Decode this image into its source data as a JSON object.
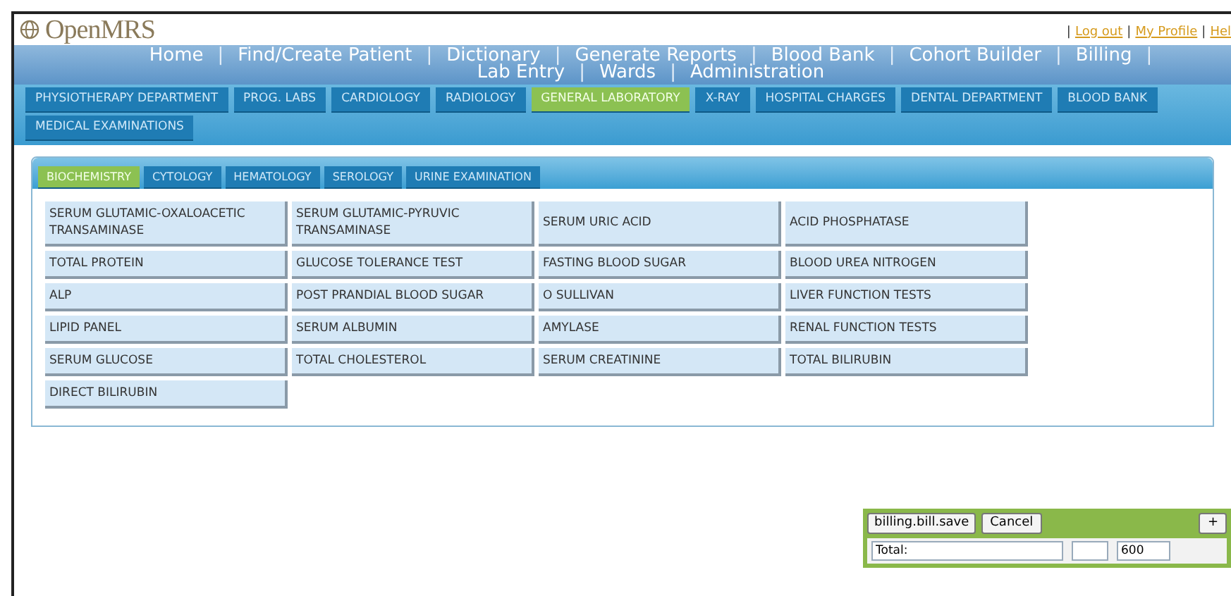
{
  "logo": {
    "text": "OpenMRS"
  },
  "top_links": [
    {
      "kind": "separator",
      "label": "|"
    },
    {
      "kind": "link",
      "label": "Log out"
    },
    {
      "kind": "separator",
      "label": "|"
    },
    {
      "kind": "link",
      "label": "My Profile"
    },
    {
      "kind": "separator",
      "label": "|"
    },
    {
      "kind": "link",
      "label": "Hel"
    }
  ],
  "nav": {
    "items": [
      {
        "kind": "link",
        "label": "Home"
      },
      {
        "kind": "separator",
        "label": "|"
      },
      {
        "kind": "link",
        "label": "Find/Create Patient"
      },
      {
        "kind": "separator",
        "label": "|"
      },
      {
        "kind": "link",
        "label": "Dictionary"
      },
      {
        "kind": "separator",
        "label": "|"
      },
      {
        "kind": "link",
        "label": "Generate Reports"
      },
      {
        "kind": "separator",
        "label": "|"
      },
      {
        "kind": "link",
        "label": "Blood Bank"
      },
      {
        "kind": "separator",
        "label": "|"
      },
      {
        "kind": "link",
        "label": "Cohort Builder"
      },
      {
        "kind": "separator",
        "label": "|"
      },
      {
        "kind": "link",
        "label": "Billing"
      },
      {
        "kind": "separator",
        "label": "|"
      },
      {
        "kind": "link",
        "label": "Lab Entry"
      },
      {
        "kind": "separator",
        "label": "|"
      },
      {
        "kind": "link",
        "label": "Wards"
      },
      {
        "kind": "separator",
        "label": "|"
      },
      {
        "kind": "link",
        "label": "Administration"
      }
    ]
  },
  "department_tabs": [
    {
      "label": "PHYSIOTHERAPY DEPARTMENT",
      "selected": false
    },
    {
      "label": "PROG. LABS",
      "selected": false
    },
    {
      "label": "CARDIOLOGY",
      "selected": false
    },
    {
      "label": "RADIOLOGY",
      "selected": false
    },
    {
      "label": "GENERAL LABORATORY",
      "selected": true
    },
    {
      "label": "X-RAY",
      "selected": false
    },
    {
      "label": "HOSPITAL CHARGES",
      "selected": false
    },
    {
      "label": "DENTAL DEPARTMENT",
      "selected": false
    },
    {
      "label": "BLOOD BANK",
      "selected": false
    },
    {
      "label": "MEDICAL EXAMINATIONS",
      "selected": false
    }
  ],
  "lab_tabs": [
    {
      "label": "BIOCHEMISTRY",
      "selected": true
    },
    {
      "label": "CYTOLOGY",
      "selected": false
    },
    {
      "label": "HEMATOLOGY",
      "selected": false
    },
    {
      "label": "SEROLOGY",
      "selected": false
    },
    {
      "label": "URINE EXAMINATION",
      "selected": false
    }
  ],
  "tests": [
    "SERUM GLUTAMIC-OXALOACETIC TRANSAMINASE",
    "SERUM GLUTAMIC-PYRUVIC TRANSAMINASE",
    "SERUM URIC ACID",
    "ACID PHOSPHATASE",
    "TOTAL PROTEIN",
    "GLUCOSE TOLERANCE TEST",
    "FASTING BLOOD SUGAR",
    "BLOOD UREA NITROGEN",
    "ALP",
    "POST PRANDIAL BLOOD SUGAR",
    "O SULLIVAN",
    "LIVER FUNCTION TESTS",
    "LIPID PANEL",
    "SERUM ALBUMIN",
    "AMYLASE",
    "RENAL FUNCTION TESTS",
    "SERUM GLUCOSE",
    "TOTAL CHOLESTEROL",
    "SERUM CREATININE",
    "TOTAL BILIRUBIN",
    "DIRECT BILIRUBIN"
  ],
  "bill": {
    "save_button": "billing.bill.save",
    "cancel_button": "Cancel",
    "add_button": "+",
    "total_label": "Total:",
    "total": "600"
  }
}
